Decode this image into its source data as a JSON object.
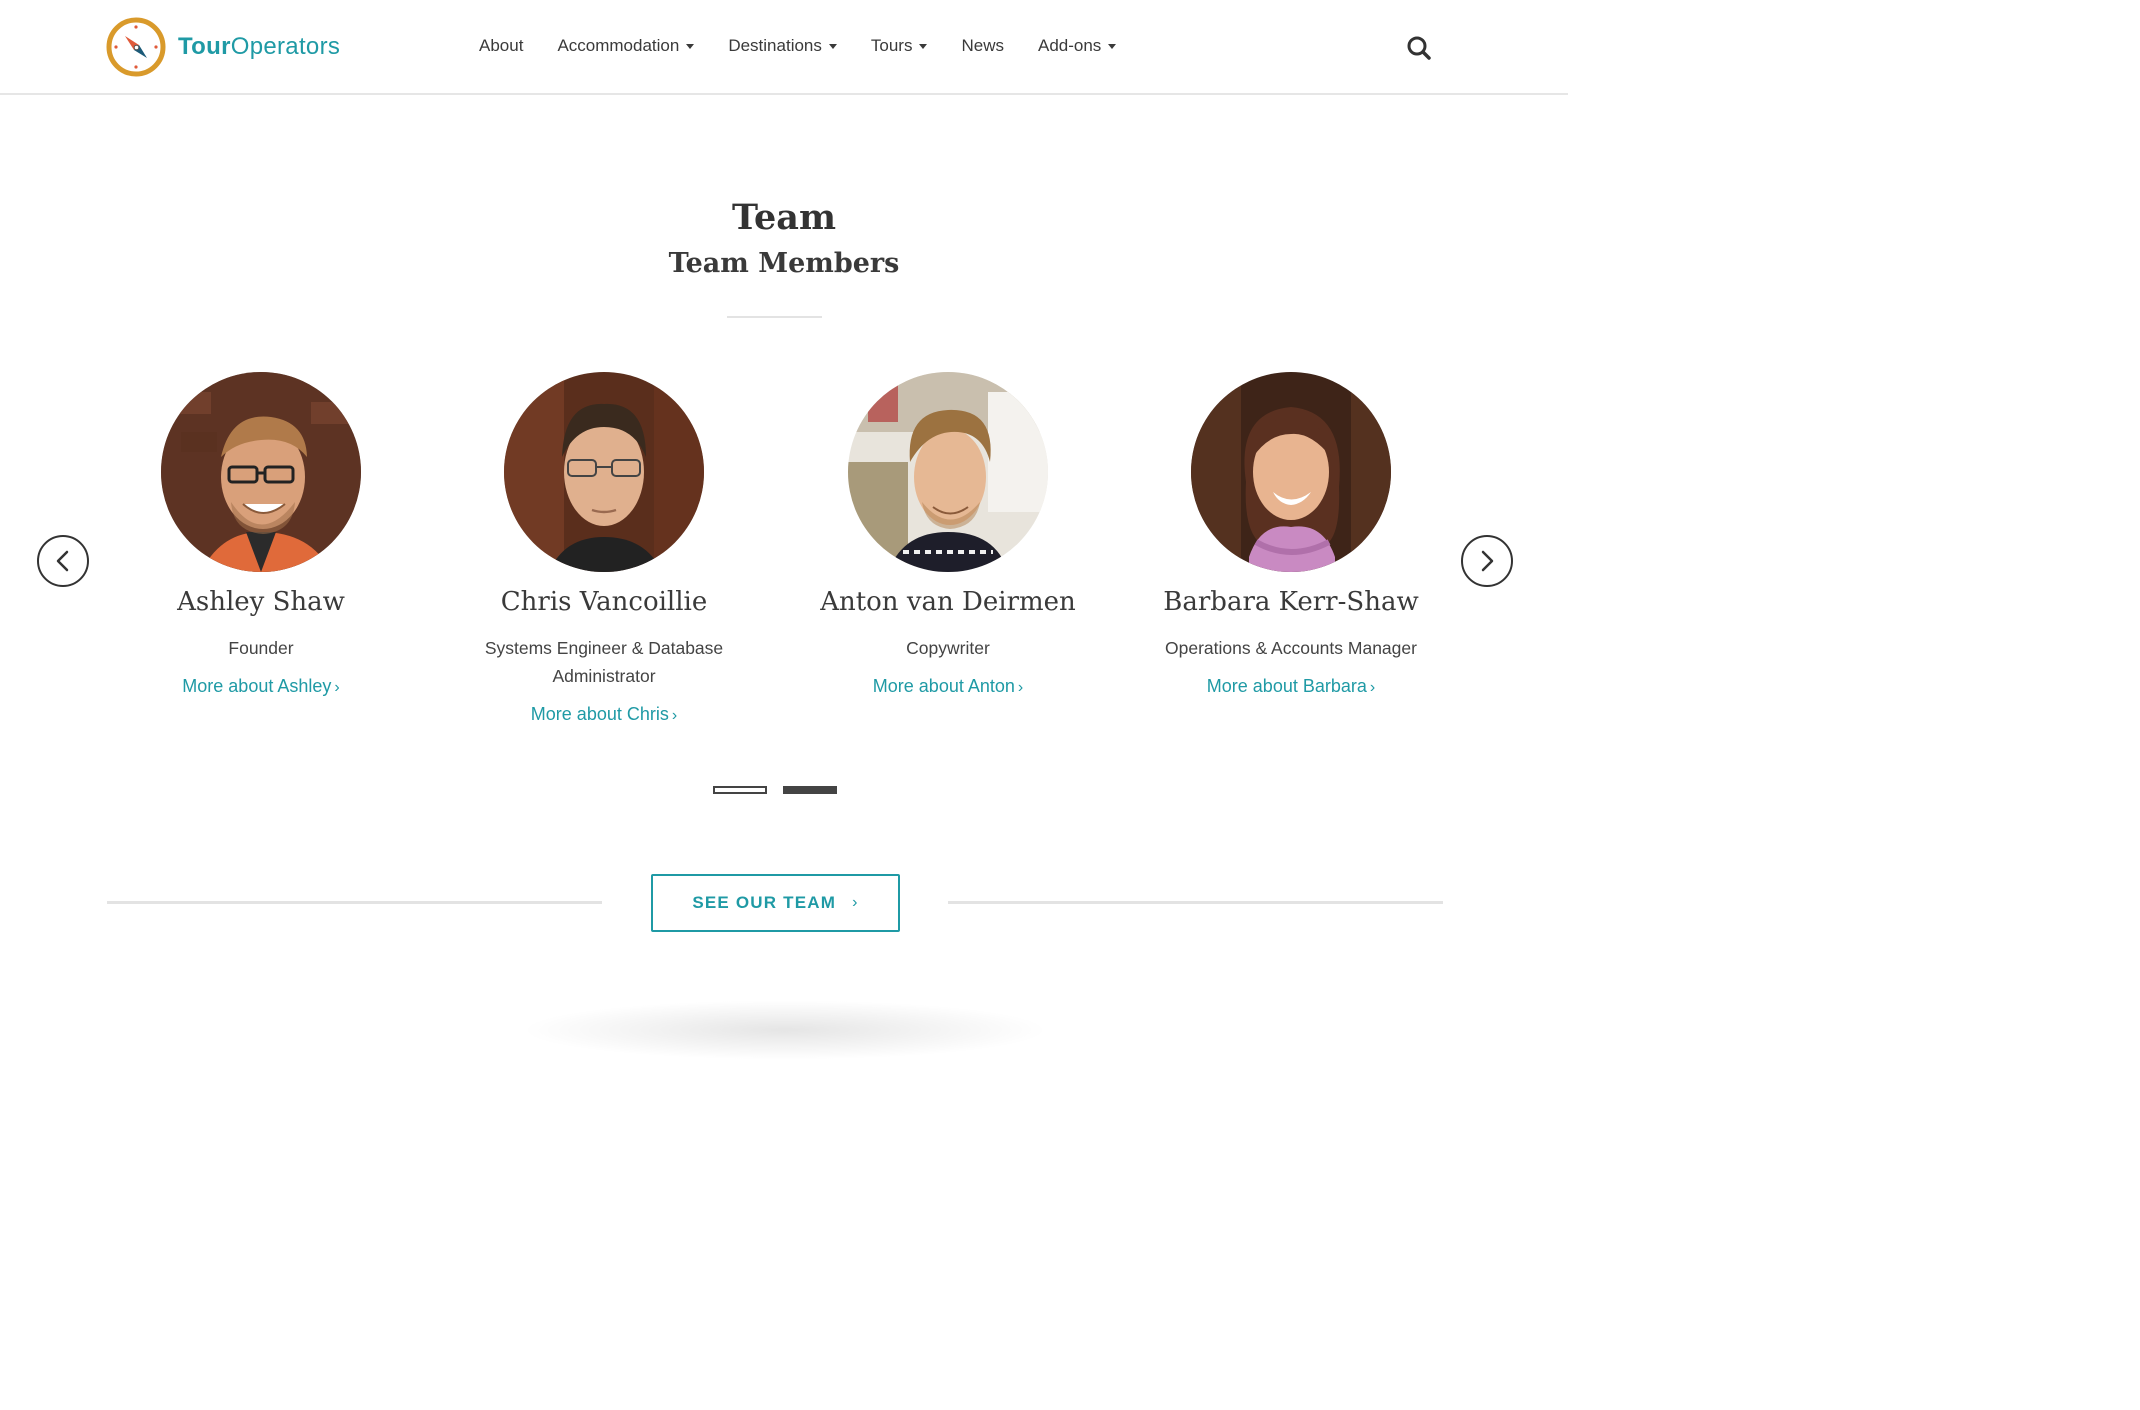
{
  "brand": {
    "name_bold": "Tour",
    "name_light": "Operators",
    "color": "#1f9aa5"
  },
  "nav": {
    "items": [
      {
        "label": "About",
        "dropdown": false
      },
      {
        "label": "Accommodation",
        "dropdown": true
      },
      {
        "label": "Destinations",
        "dropdown": true
      },
      {
        "label": "Tours",
        "dropdown": true
      },
      {
        "label": "News",
        "dropdown": false
      },
      {
        "label": "Add-ons",
        "dropdown": true
      }
    ],
    "search_icon": "search-icon"
  },
  "team": {
    "title": "Team",
    "subtitle": "Team Members",
    "members": [
      {
        "name": "Ashley Shaw",
        "role": "Founder",
        "link": "More about Ashley"
      },
      {
        "name": "Chris Vancoillie",
        "role": "Systems Engineer & Database Administrator",
        "link": "More about Chris"
      },
      {
        "name": "Anton van Deirmen",
        "role": "Copywriter",
        "link": "More about Anton"
      },
      {
        "name": "Barbara Kerr-Shaw",
        "role": "Operations & Accounts Manager",
        "link": "More about Barbara"
      }
    ],
    "carousel": {
      "pages": 2,
      "active_page": 2,
      "prev_icon": "chevron-left-icon",
      "next_icon": "chevron-right-icon"
    }
  },
  "cta": {
    "label": "SEE OUR TEAM",
    "icon": "chevron-right-icon"
  }
}
